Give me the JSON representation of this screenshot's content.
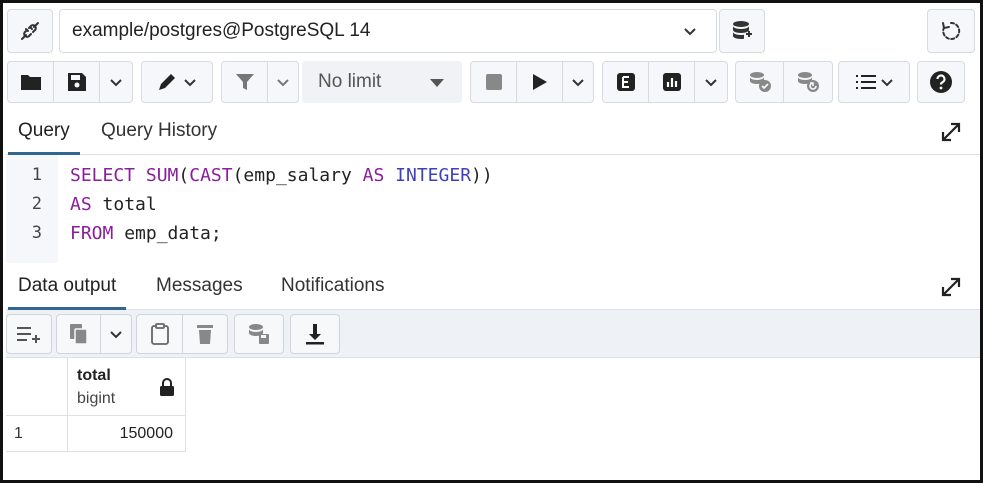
{
  "connection": {
    "label": "example/postgres@PostgreSQL 14"
  },
  "toolbar": {
    "limit_label": "No limit"
  },
  "query_tabs": [
    {
      "label": "Query",
      "active": true
    },
    {
      "label": "Query History",
      "active": false
    }
  ],
  "editor": {
    "line_numbers": [
      "1",
      "2",
      "3"
    ],
    "lines": [
      [
        {
          "t": "SELECT",
          "c": "kw"
        },
        {
          "t": " ",
          "c": ""
        },
        {
          "t": "SUM",
          "c": "fn"
        },
        {
          "t": "(",
          "c": ""
        },
        {
          "t": "CAST",
          "c": "fn"
        },
        {
          "t": "(emp_salary ",
          "c": ""
        },
        {
          "t": "AS",
          "c": "kw"
        },
        {
          "t": " ",
          "c": ""
        },
        {
          "t": "INTEGER",
          "c": "ty"
        },
        {
          "t": "))",
          "c": ""
        }
      ],
      [
        {
          "t": "AS",
          "c": "kw"
        },
        {
          "t": " total",
          "c": ""
        }
      ],
      [
        {
          "t": "FROM",
          "c": "kw"
        },
        {
          "t": " emp_data;",
          "c": ""
        }
      ]
    ]
  },
  "output_tabs": [
    {
      "label": "Data output",
      "active": true
    },
    {
      "label": "Messages",
      "active": false
    },
    {
      "label": "Notifications",
      "active": false
    }
  ],
  "result": {
    "columns": [
      {
        "name": "total",
        "type": "bigint"
      }
    ],
    "rows": [
      {
        "num": "1",
        "values": [
          "150000"
        ]
      }
    ]
  },
  "colors": {
    "accent": "#326690",
    "keyword": "#8b1c9c",
    "type": "#3d3fbd"
  }
}
